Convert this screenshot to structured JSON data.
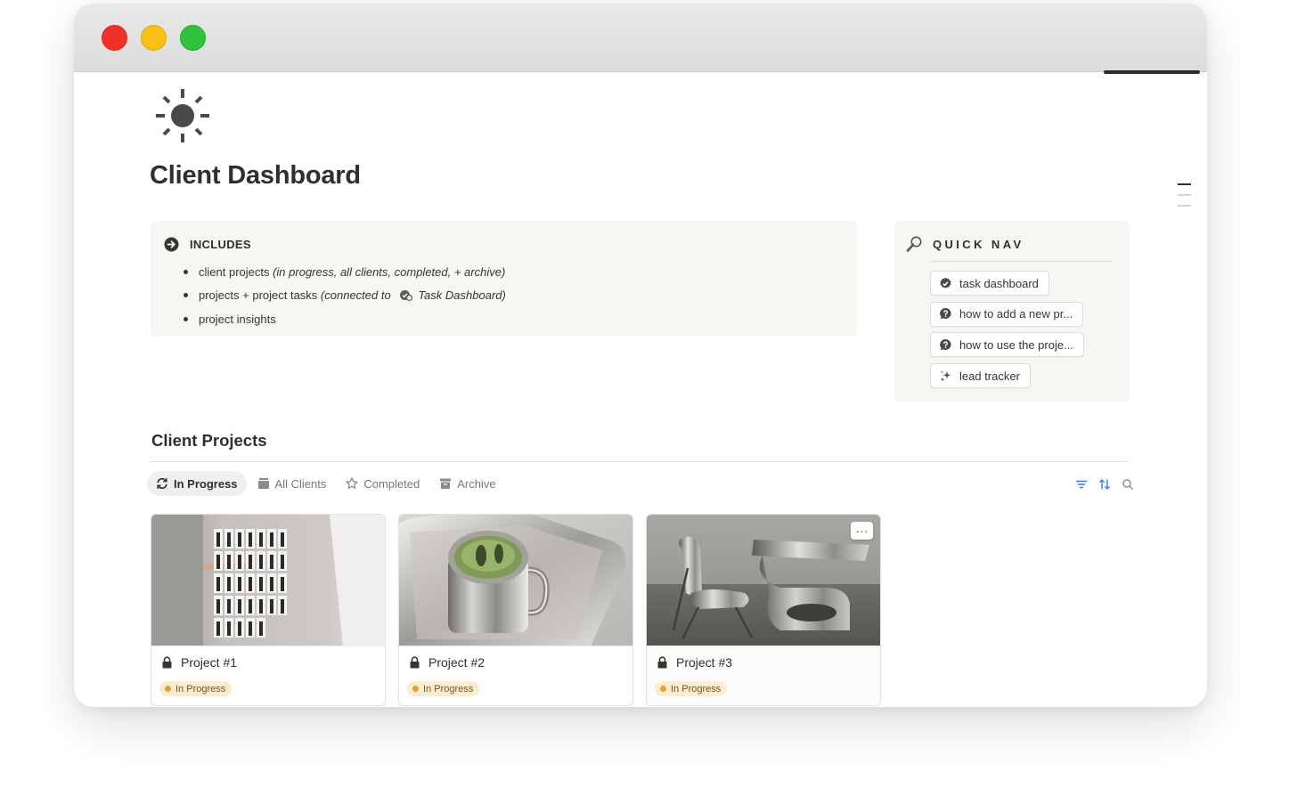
{
  "page": {
    "title": "Client Dashboard",
    "icon": "sun-icon"
  },
  "callout": {
    "icon": "arrow-right-circle-icon",
    "title": "INCLUDES",
    "items": [
      {
        "text": "client projects ",
        "italic": "(in progress, all clients, completed, + archive)"
      },
      {
        "text": "projects + project tasks ",
        "italic_pre": "(connected to ",
        "link_icon": "task-check-icon",
        "link": "Task Dashboard",
        "italic_post": ")"
      },
      {
        "text": "project insights"
      }
    ]
  },
  "quicknav": {
    "icon": "magnifier-icon",
    "title": "QUICK NAV",
    "buttons": [
      {
        "label": "task dashboard",
        "icon": "check-badge-icon"
      },
      {
        "label": "how to add a new pr...",
        "icon": "question-bubble-icon"
      },
      {
        "label": "how to use the proje...",
        "icon": "question-bubble-icon"
      },
      {
        "label": "lead tracker",
        "icon": "sparkle-icon"
      }
    ]
  },
  "projects": {
    "section_title": "Client Projects",
    "tabs": [
      {
        "label": "In Progress",
        "icon": "refresh-icon",
        "active": true
      },
      {
        "label": "All Clients",
        "icon": "stack-icon",
        "active": false
      },
      {
        "label": "Completed",
        "icon": "star-icon",
        "active": false
      },
      {
        "label": "Archive",
        "icon": "archive-box-icon",
        "active": false
      }
    ],
    "tools": [
      "filter-icon",
      "sort-icon",
      "search-icon"
    ],
    "cards": [
      {
        "name": "Project #1",
        "status": "In Progress",
        "cover": "gallery wall with fashion photos"
      },
      {
        "name": "Project #2",
        "status": "In Progress",
        "cover": "steel cup with matcha on tray"
      },
      {
        "name": "Project #3",
        "status": "In Progress",
        "cover": "chrome chair and table"
      }
    ],
    "more_label": "···"
  },
  "colors": {
    "callout_bg": "#f7f6f3",
    "badge_bg": "#fbeccd",
    "badge_dot": "#e0a236",
    "accent_blue": "#2f80ed"
  }
}
